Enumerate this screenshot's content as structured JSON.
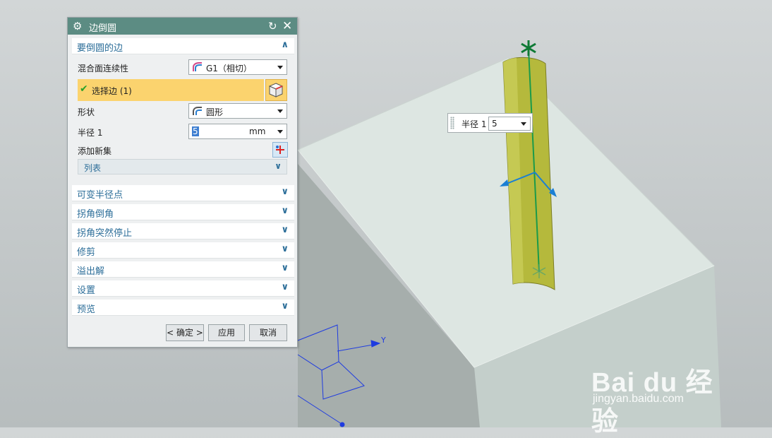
{
  "dialog": {
    "title": "边倒圆",
    "groups": {
      "edge": {
        "label": "要倒圆的边"
      },
      "collapsed": [
        {
          "label": "可变半径点"
        },
        {
          "label": "拐角倒角"
        },
        {
          "label": "拐角突然停止"
        },
        {
          "label": "修剪"
        },
        {
          "label": "溢出解"
        },
        {
          "label": "设置"
        },
        {
          "label": "预览"
        }
      ]
    },
    "blend_continuity": {
      "label": "混合面连续性",
      "value": "G1（相切）"
    },
    "select_edge": {
      "label": "选择边 (1)"
    },
    "shape": {
      "label": "形状",
      "value": "圆形"
    },
    "radius": {
      "label": "半径 1",
      "value": "5",
      "unit": "mm"
    },
    "add_new_set": {
      "label": "添加新集"
    },
    "list": {
      "label": "列表"
    },
    "buttons": {
      "ok": "< 确定 >",
      "apply": "应用",
      "cancel": "取消"
    }
  },
  "floating_radius": {
    "label": "半径 1",
    "value": "5"
  },
  "axis": {
    "y_label": "Y"
  },
  "watermark": {
    "brand": "Bai du 经验",
    "url": "jingyan.baidu.com"
  },
  "colors": {
    "title_bar": "#5c8c83",
    "group_label": "#2c6e99",
    "selection": "#fbd36e",
    "block_face_top": "#dde6e2",
    "cylinder": "#b5b93c",
    "edge_curve": "#1a9a4a",
    "triad": "#1a7fd4"
  },
  "icons": [
    "gear-icon",
    "reset-icon",
    "close-icon",
    "chevron-up-icon",
    "chevron-down-icon",
    "check-icon",
    "cube-select-icon",
    "add-set-icon",
    "continuity-icon",
    "shape-icon"
  ]
}
